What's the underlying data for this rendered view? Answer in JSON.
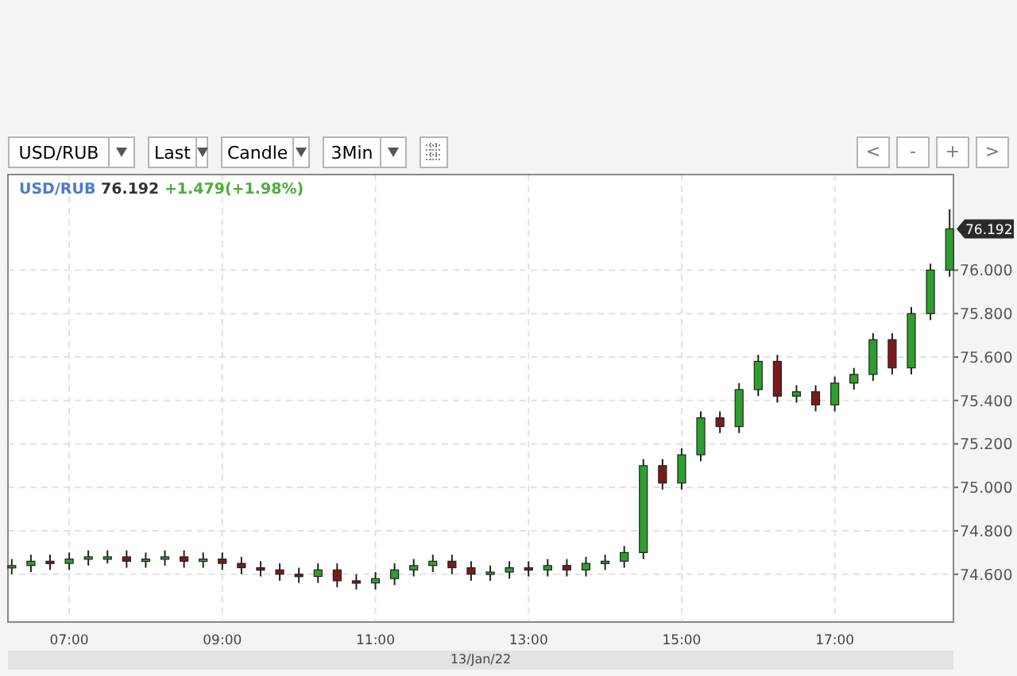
{
  "toolbar": {
    "dropdowns": [
      {
        "value": "USD/RUB"
      },
      {
        "value": "Last"
      },
      {
        "value": "Candle"
      },
      {
        "value": "3Min"
      }
    ],
    "nav_buttons": [
      "<",
      "-",
      "+",
      ">"
    ]
  },
  "chart": {
    "last": "76.192",
    "change": "+1.479(+1.98%)",
    "chart_data": {
      "type": "candlestick",
      "xlabel": "13/Jan/22",
      "grid": true,
      "x": [
        6.25,
        6.5,
        6.75,
        7,
        7.25,
        7.5,
        7.75,
        8,
        8.25,
        8.5,
        8.75,
        9,
        9.25,
        9.5,
        9.75,
        10,
        10.25,
        10.5,
        10.75,
        11,
        11.25,
        11.5,
        11.75,
        12,
        12.25,
        12.5,
        12.75,
        13,
        13.25,
        13.5,
        13.75,
        14,
        14.25,
        14.5,
        14.75,
        15,
        15.25,
        15.5,
        15.75,
        16,
        16.25,
        16.5,
        16.75,
        17,
        17.25,
        17.5,
        17.75,
        18,
        18.25,
        18.5
      ],
      "series": [
        {
          "name": "USD/RUB",
          "ohlc": [
            [
              74.63,
              74.67,
              74.6,
              74.64
            ],
            [
              74.64,
              74.69,
              74.61,
              74.66
            ],
            [
              74.66,
              74.69,
              74.62,
              74.65
            ],
            [
              74.65,
              74.7,
              74.62,
              74.67
            ],
            [
              74.67,
              74.71,
              74.64,
              74.68
            ],
            [
              74.68,
              74.71,
              74.65,
              74.68
            ],
            [
              74.68,
              74.71,
              74.63,
              74.66
            ],
            [
              74.66,
              74.7,
              74.63,
              74.67
            ],
            [
              74.67,
              74.71,
              74.64,
              74.68
            ],
            [
              74.68,
              74.71,
              74.63,
              74.66
            ],
            [
              74.66,
              74.7,
              74.63,
              74.67
            ],
            [
              74.67,
              74.7,
              74.62,
              74.65
            ],
            [
              74.65,
              74.68,
              74.6,
              74.63
            ],
            [
              74.63,
              74.66,
              74.59,
              74.62
            ],
            [
              74.62,
              74.65,
              74.57,
              74.6
            ],
            [
              74.6,
              74.63,
              74.56,
              74.59
            ],
            [
              74.59,
              74.65,
              74.56,
              74.62
            ],
            [
              74.62,
              74.65,
              74.54,
              74.57
            ],
            [
              74.57,
              74.6,
              74.53,
              74.56
            ],
            [
              74.56,
              74.61,
              74.53,
              74.58
            ],
            [
              74.58,
              74.65,
              74.55,
              74.62
            ],
            [
              74.62,
              74.67,
              74.59,
              74.64
            ],
            [
              74.64,
              74.69,
              74.61,
              74.66
            ],
            [
              74.66,
              74.69,
              74.6,
              74.63
            ],
            [
              74.63,
              74.66,
              74.57,
              74.6
            ],
            [
              74.6,
              74.64,
              74.57,
              74.61
            ],
            [
              74.61,
              74.66,
              74.58,
              74.63
            ],
            [
              74.63,
              74.66,
              74.59,
              74.62
            ],
            [
              74.62,
              74.67,
              74.59,
              74.64
            ],
            [
              74.64,
              74.67,
              74.59,
              74.62
            ],
            [
              74.62,
              74.68,
              74.59,
              74.65
            ],
            [
              74.65,
              74.69,
              74.62,
              74.66
            ],
            [
              74.66,
              74.73,
              74.63,
              74.7
            ],
            [
              74.7,
              75.13,
              74.67,
              75.1
            ],
            [
              75.1,
              75.13,
              74.99,
              75.02
            ],
            [
              75.02,
              75.18,
              74.99,
              75.15
            ],
            [
              75.15,
              75.35,
              75.12,
              75.32
            ],
            [
              75.32,
              75.35,
              75.25,
              75.28
            ],
            [
              75.28,
              75.48,
              75.25,
              75.45
            ],
            [
              75.45,
              75.61,
              75.42,
              75.58
            ],
            [
              75.58,
              75.61,
              75.39,
              75.42
            ],
            [
              75.42,
              75.47,
              75.39,
              75.44
            ],
            [
              75.44,
              75.47,
              75.35,
              75.38
            ],
            [
              75.38,
              75.51,
              75.35,
              75.48
            ],
            [
              75.48,
              75.55,
              75.45,
              75.52
            ],
            [
              75.52,
              75.71,
              75.49,
              75.68
            ],
            [
              75.68,
              75.71,
              75.52,
              75.55
            ],
            [
              75.55,
              75.83,
              75.52,
              75.8
            ],
            [
              75.8,
              76.03,
              75.77,
              76.0
            ],
            [
              76.0,
              76.28,
              75.97,
              76.19
            ]
          ]
        }
      ],
      "xlim": [
        6.2,
        18.55
      ],
      "ylim": [
        74.38,
        76.44
      ],
      "xticks": [
        {
          "value": 7,
          "label": "07:00"
        },
        {
          "value": 9,
          "label": "09:00"
        },
        {
          "value": 11,
          "label": "11:00"
        },
        {
          "value": 13,
          "label": "13:00"
        },
        {
          "value": 15,
          "label": "15:00"
        },
        {
          "value": 17,
          "label": "17:00"
        }
      ],
      "yticks": [
        {
          "value": 74.6,
          "label": "74.600"
        },
        {
          "value": 74.8,
          "label": "74.800"
        },
        {
          "value": 75,
          "label": "75.000"
        },
        {
          "value": 75.2,
          "label": "75.200"
        },
        {
          "value": 75.4,
          "label": "75.400"
        },
        {
          "value": 75.6,
          "label": "75.600"
        },
        {
          "value": 75.8,
          "label": "75.800"
        },
        {
          "value": 76,
          "label": "76.000"
        }
      ],
      "annotations": [
        "76.192"
      ]
    }
  }
}
